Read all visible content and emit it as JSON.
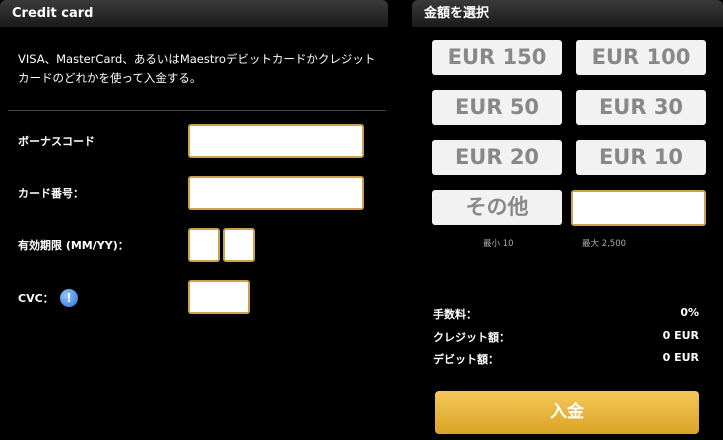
{
  "credit_card": {
    "title": "Credit card",
    "description": "VISA、MasterCard、あるいはMaestroデビットカードかクレジットカードのどれかを使って入金する。",
    "fields": {
      "bonus_code_label": "ボーナスコード",
      "card_number_label": "カード番号：",
      "expiry_label": "有効期限 (MM/YY)：",
      "cvc_label": "CVC："
    },
    "info_icon_glyph": "!"
  },
  "amount": {
    "title": "金額を選択",
    "options": [
      "EUR 150",
      "EUR 100",
      "EUR 50",
      "EUR 30",
      "EUR 20",
      "EUR 10"
    ],
    "other_label": "その他",
    "min_hint": "最小 10",
    "max_hint": "最大 2,500"
  },
  "summary": {
    "fee_label": "手数料：",
    "fee_value": "0%",
    "credit_label": "クレジット額：",
    "credit_value": "0 EUR",
    "debit_label": "デビット額：",
    "debit_value": "0 EUR"
  },
  "deposit_button": "入金",
  "colors": {
    "accent_gold": "#d9a326",
    "input_border": "#c9a24a",
    "info_icon": "#2f73d6"
  }
}
